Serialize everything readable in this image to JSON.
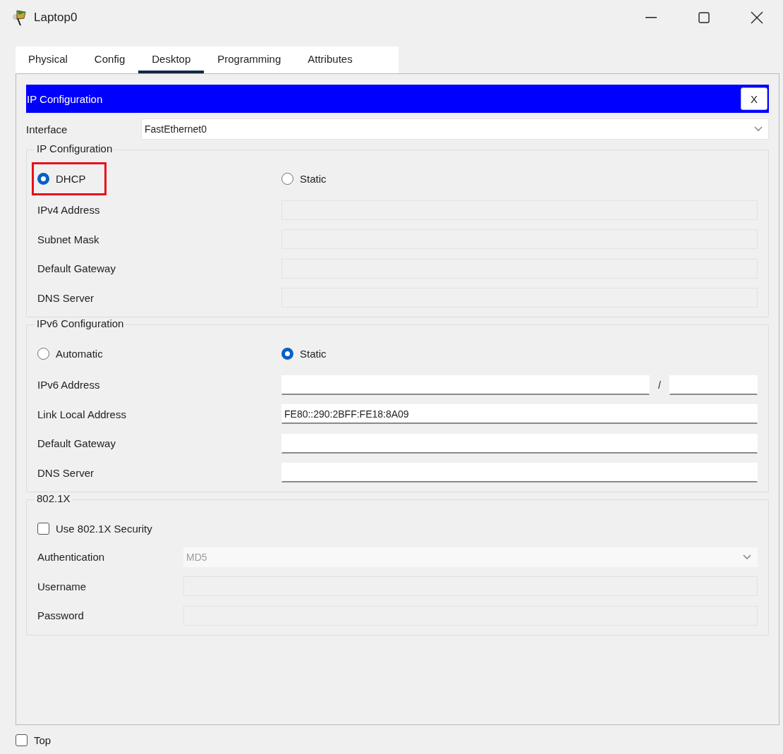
{
  "window": {
    "title": "Laptop0"
  },
  "tabs": [
    {
      "label": "Physical",
      "selected": false
    },
    {
      "label": "Config",
      "selected": false
    },
    {
      "label": "Desktop",
      "selected": true
    },
    {
      "label": "Programming",
      "selected": false
    },
    {
      "label": "Attributes",
      "selected": false
    }
  ],
  "panel": {
    "title": "IP Configuration",
    "close": "X"
  },
  "interface": {
    "label": "Interface",
    "value": "FastEthernet0"
  },
  "ipv4": {
    "title": "IP Configuration",
    "modes": [
      {
        "label": "DHCP",
        "selected": true,
        "highlighted": true
      },
      {
        "label": "Static",
        "selected": false,
        "highlighted": false
      }
    ],
    "fields": [
      {
        "label": "IPv4 Address",
        "kind": "text",
        "disabled": true
      },
      {
        "label": "Subnet Mask",
        "kind": "text",
        "disabled": true
      },
      {
        "label": "Default Gateway",
        "kind": "text",
        "disabled": true
      },
      {
        "label": "DNS Server",
        "kind": "text",
        "disabled": true
      }
    ]
  },
  "ipv6": {
    "title": "IPv6 Configuration",
    "modes": [
      {
        "label": "Automatic",
        "selected": false,
        "highlighted": false
      },
      {
        "label": "Static",
        "selected": true,
        "highlighted": false
      }
    ],
    "fields": [
      {
        "label": "IPv6 Address",
        "kind": "prefix",
        "separator": "/",
        "disabled": false
      },
      {
        "label": "Link Local Address",
        "kind": "text",
        "value": "FE80::290:2BFF:FE18:8A09",
        "disabled": false
      },
      {
        "label": "Default Gateway",
        "kind": "text",
        "disabled": false
      },
      {
        "label": "DNS Server",
        "kind": "text",
        "disabled": false
      }
    ]
  },
  "dot1x": {
    "title": "802.1X",
    "checkbox": {
      "label": "Use 802.1X Security",
      "checked": false
    },
    "fields": [
      {
        "label": "Authentication",
        "kind": "dropdown",
        "value": "MD5",
        "disabled": true
      },
      {
        "label": "Username",
        "kind": "text",
        "disabled": true
      },
      {
        "label": "Password",
        "kind": "text",
        "disabled": true
      }
    ]
  },
  "footer": {
    "label": "Top",
    "checked": false
  }
}
